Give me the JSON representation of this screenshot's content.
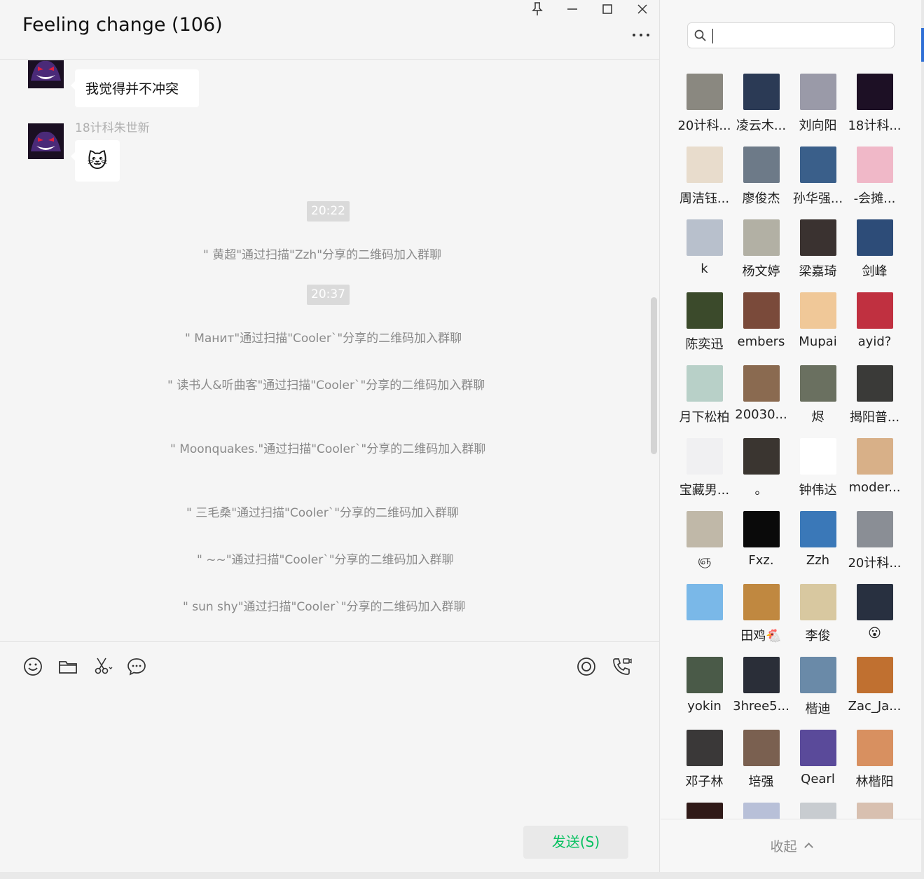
{
  "window": {
    "title": "Feeling change (106)",
    "controls": {
      "pin_icon": "pin-icon",
      "minimize_icon": "minimize-icon",
      "maximize_icon": "maximize-icon",
      "close_icon": "close-icon",
      "more_icon": "more-icon"
    }
  },
  "messages": {
    "first_bubble_text": "我觉得并不冲突",
    "second_sender": "18计科朱世新",
    "second_bubble_emoji": "🐱",
    "time_1": "20:22",
    "system_1": "\" 黄超\"通过扫描\"Zzh\"分享的二维码加入群聊",
    "time_2": "20:37",
    "system_2": "\" Манит\"通过扫描\"Cooler`\"分享的二维码加入群聊",
    "system_3": "\" 读书人&听曲客\"通过扫描\"Cooler`\"分享的二维码加入群聊",
    "system_4": "\" Moonquakes.\"通过扫描\"Cooler`\"分享的二维码加入群聊",
    "system_5": "\" 三毛桑\"通过扫描\"Cooler`\"分享的二维码加入群聊",
    "system_6": "\" ~~\"通过扫描\"Cooler`\"分享的二维码加入群聊",
    "system_7": "\" sun shy\"通过扫描\"Cooler`\"分享的二维码加入群聊"
  },
  "composer": {
    "tools": [
      "emoji-icon",
      "folder-icon",
      "scissors-icon",
      "chat-bubble-icon",
      "live-icon",
      "voice-call-icon"
    ],
    "send_label": "发送(S)",
    "send_color": "#07c160"
  },
  "panel": {
    "search": {
      "value": "",
      "placeholder": ""
    },
    "collapse_label": "收起",
    "members": [
      "20计科...",
      "凌云木...",
      "刘向阳",
      "18计科...",
      "周洁钰...",
      "廖俊杰",
      "孙华强...",
      "-会摊...",
      "k",
      "杨文婷",
      "梁嘉琦",
      "剑峰",
      "陈奕迅",
      "embers",
      "Mupai",
      "ayid?",
      "月下松柏",
      "20030...",
      "烬",
      "揭阳普...",
      "宝藏男...",
      "。",
      "钟伟达",
      "moder...",
      "ஞ",
      "Fxz.",
      "Zzh",
      "20计科...",
      "",
      "田鸡🐔",
      "李俊",
      "😮",
      "yokin",
      "3hree5...",
      "楷迪",
      "Zac_Ja...",
      "邓子林",
      "培强",
      "Qearl",
      "林楷阳",
      "",
      "",
      "",
      ""
    ],
    "member_colors": [
      "#8a8880",
      "#2b3a55",
      "#9a9aa8",
      "#1d1025",
      "#e8dccc",
      "#6d7a88",
      "#3a5f8a",
      "#f0b8c8",
      "#b8c0cc",
      "#b2b0a4",
      "#3a3230",
      "#2d4c78",
      "#3b4a2b",
      "#7a4a3a",
      "#f0c898",
      "#c03040",
      "#b8d0c8",
      "#8a6a50",
      "#6a7060",
      "#3a3a38",
      "#f0f0f2",
      "#3a3530",
      "#ffffff",
      "#d8b088",
      "#c0b8a8",
      "#0a0a0a",
      "#3a78b8",
      "#8a8e95",
      "#7ab8e8",
      "#c08840",
      "#d8c8a0",
      "#283040",
      "#4a5a48",
      "#2a2e38",
      "#6a8aa8",
      "#c07030",
      "#3a3838",
      "#7a6050",
      "#5a4a9a",
      "#d89060",
      "#301a18",
      "#b8c0d8",
      "#c8ccd0",
      "#d8c0b0"
    ]
  }
}
